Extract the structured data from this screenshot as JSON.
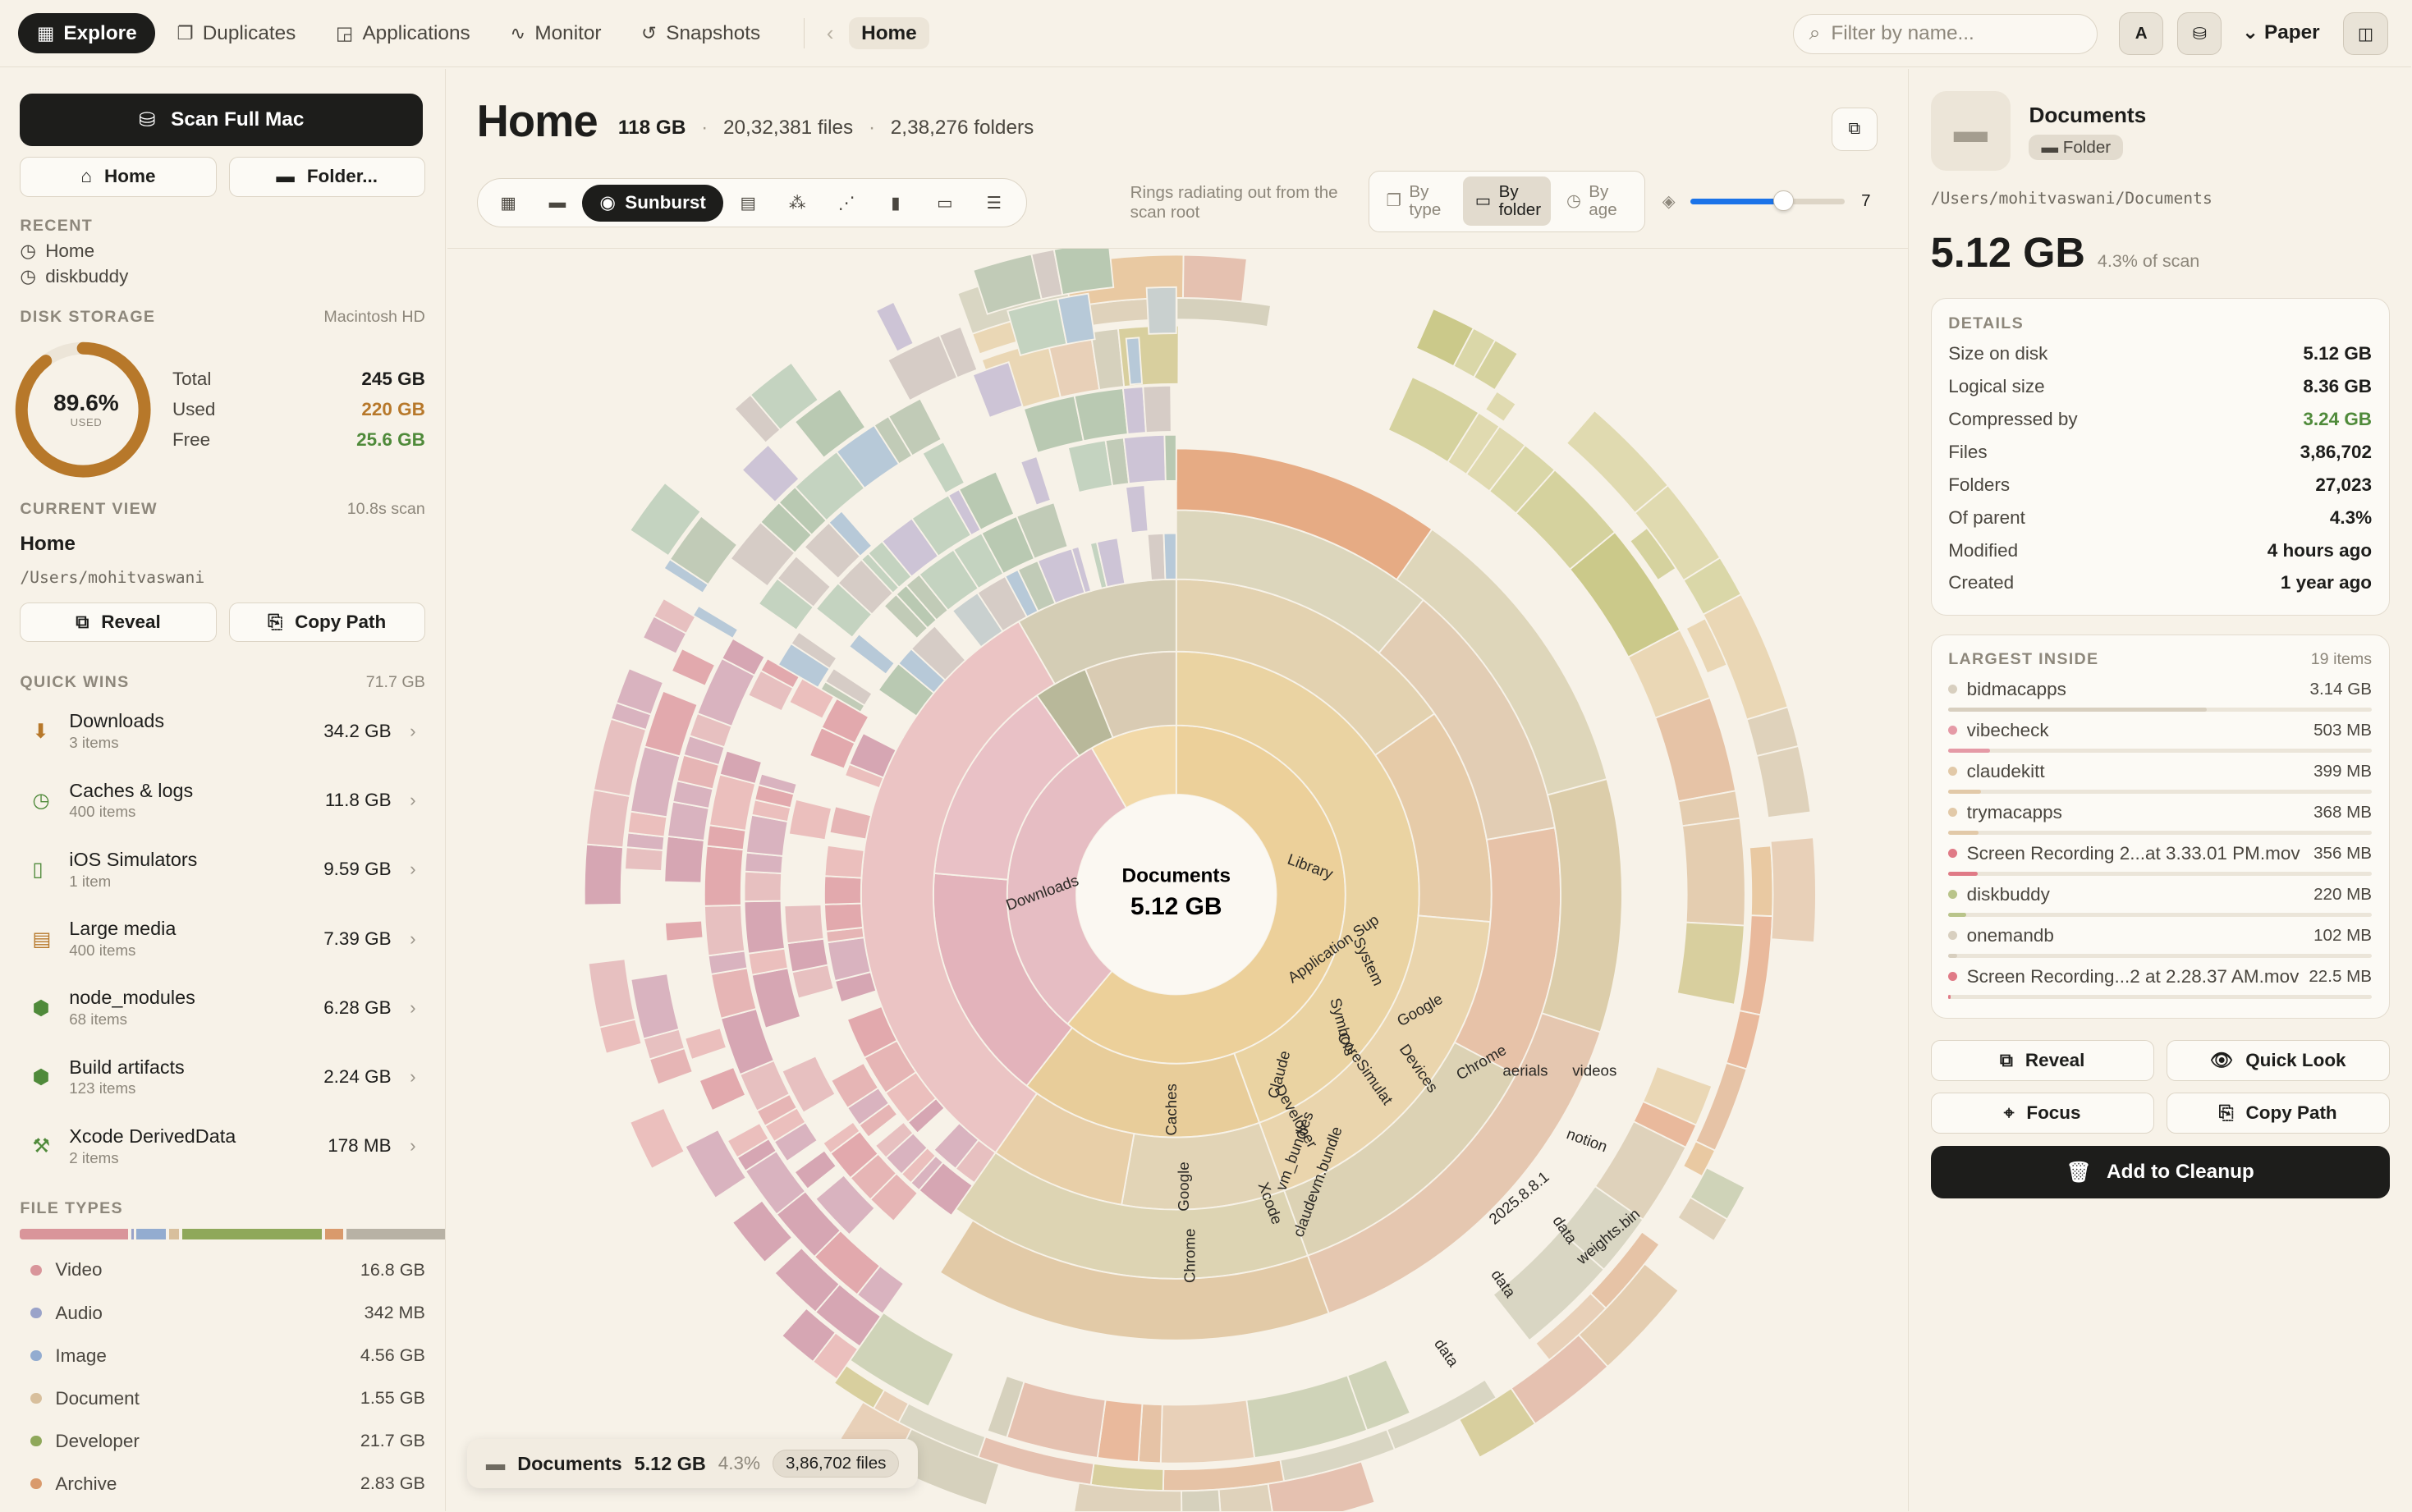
{
  "nav": {
    "tabs": [
      {
        "label": "Explore",
        "icon": "grid-icon"
      },
      {
        "label": "Duplicates",
        "icon": "copy-icon"
      },
      {
        "label": "Applications",
        "icon": "app-icon"
      },
      {
        "label": "Monitor",
        "icon": "pulse-icon"
      },
      {
        "label": "Snapshots",
        "icon": "history-icon"
      }
    ],
    "breadcrumb": "Home",
    "search_placeholder": "Filter by name...",
    "avatar_letter": "A",
    "theme_label": "Paper"
  },
  "sidebar": {
    "scan_label": "Scan Full Mac",
    "home_label": "Home",
    "folder_label": "Folder...",
    "recent_title": "RECENT",
    "recent": [
      "Home",
      "diskbuddy"
    ],
    "disk_title": "DISK STORAGE",
    "disk_name": "Macintosh HD",
    "disk_pct": "89.6%",
    "disk_pct_value": 0.896,
    "disk_used_label": "USED",
    "disk_stats": [
      {
        "label": "Total",
        "value": "245 GB",
        "color": "#1d1d1b"
      },
      {
        "label": "Used",
        "value": "220 GB",
        "color": "#b7782a"
      },
      {
        "label": "Free",
        "value": "25.6 GB",
        "color": "#4f8a3a"
      }
    ],
    "current_title": "CURRENT VIEW",
    "current_meta": "10.8s scan",
    "current_name": "Home",
    "current_path": "/Users/mohitvaswani",
    "reveal_label": "Reveal",
    "copy_path_label": "Copy Path",
    "quickwins_title": "QUICK WINS",
    "quickwins_total": "71.7 GB",
    "quickwins": [
      {
        "name": "Downloads",
        "sub": "3 items",
        "size": "34.2 GB",
        "icon": "download-icon"
      },
      {
        "name": "Caches & logs",
        "sub": "400 items",
        "size": "11.8 GB",
        "icon": "clock-icon"
      },
      {
        "name": "iOS Simulators",
        "sub": "1 item",
        "size": "9.59 GB",
        "icon": "phone-icon"
      },
      {
        "name": "Large media",
        "sub": "400 items",
        "size": "7.39 GB",
        "icon": "film-icon"
      },
      {
        "name": "node_modules",
        "sub": "68 items",
        "size": "6.28 GB",
        "icon": "package-icon"
      },
      {
        "name": "Build artifacts",
        "sub": "123 items",
        "size": "2.24 GB",
        "icon": "box-icon"
      },
      {
        "name": "Xcode DerivedData",
        "sub": "2 items",
        "size": "178 MB",
        "icon": "hammer-icon"
      }
    ],
    "filetypes_title": "FILE TYPES",
    "filetypes": [
      {
        "name": "Video",
        "size": "16.8 GB",
        "color": "#d9959a",
        "gb": 16.8
      },
      {
        "name": "Audio",
        "size": "342 MB",
        "color": "#9aa3c9",
        "gb": 0.342
      },
      {
        "name": "Image",
        "size": "4.56 GB",
        "color": "#93acd0",
        "gb": 4.56
      },
      {
        "name": "Document",
        "size": "1.55 GB",
        "color": "#d8bf9c",
        "gb": 1.55
      },
      {
        "name": "Developer",
        "size": "21.7 GB",
        "color": "#8fa85a",
        "gb": 21.7
      },
      {
        "name": "Archive",
        "size": "2.83 GB",
        "color": "#d99a6c",
        "gb": 2.83
      }
    ]
  },
  "main": {
    "title": "Home",
    "size": "118 GB",
    "files": "20,32,381 files",
    "folders": "2,38,276 folders",
    "active_view": "Sunburst",
    "view_description": "Rings radiating out from the scan root",
    "color_by": [
      {
        "label": "By type"
      },
      {
        "label": "By folder"
      },
      {
        "label": "By age"
      }
    ],
    "depth_value": "7",
    "depth_fraction": 0.6,
    "center_name": "Documents",
    "center_size": "5.12 GB",
    "ring_labels": [
      "Downloads",
      "Library",
      "Application Sup",
      "Claude",
      "vm_bundles",
      "claudevm.bundle",
      "Google",
      "Chrome",
      "aerials",
      "videos",
      "notion",
      "2025.8.8.1",
      "weights.bin",
      "Developer",
      "CoreSimulat",
      "Devices",
      "Caches",
      "Google",
      "Chrome",
      "Xcode",
      "Symbols",
      "System",
      "data",
      "data",
      "data"
    ],
    "hover": {
      "name": "Documents",
      "size": "5.12 GB",
      "pct": "4.3%",
      "files": "3,86,702 files"
    }
  },
  "details": {
    "name": "Documents",
    "kind": "Folder",
    "path": "/Users/mohitvaswani/Documents",
    "size": "5.12 GB",
    "pct": "4.3% of scan",
    "details_title": "DETAILS",
    "rows": [
      {
        "label": "Size on disk",
        "value": "5.12 GB"
      },
      {
        "label": "Logical size",
        "value": "8.36 GB"
      },
      {
        "label": "Compressed by",
        "value": "3.24 GB"
      },
      {
        "label": "Files",
        "value": "3,86,702"
      },
      {
        "label": "Folders",
        "value": "27,023"
      },
      {
        "label": "Of parent",
        "value": "4.3%"
      },
      {
        "label": "Modified",
        "value": "4 hours ago"
      },
      {
        "label": "Created",
        "value": "1 year ago"
      }
    ],
    "largest_title": "LARGEST INSIDE",
    "largest_count": "19 items",
    "largest": [
      {
        "name": "bidmacapps",
        "size": "3.14 GB",
        "color": "#d8cfbf",
        "fraction": 0.61
      },
      {
        "name": "vibecheck",
        "size": "503 MB",
        "color": "#e59aa6",
        "fraction": 0.098
      },
      {
        "name": "claudekitt",
        "size": "399 MB",
        "color": "#e2c9a8",
        "fraction": 0.078
      },
      {
        "name": "trymacapps",
        "size": "368 MB",
        "color": "#e2c9a8",
        "fraction": 0.072
      },
      {
        "name": "Screen Recording 2...at 3.33.01 PM.mov",
        "size": "356 MB",
        "color": "#e07a86",
        "fraction": 0.07
      },
      {
        "name": "diskbuddy",
        "size": "220 MB",
        "color": "#b9c48a",
        "fraction": 0.043
      },
      {
        "name": "onemandb",
        "size": "102 MB",
        "color": "#d8cfbf",
        "fraction": 0.02
      },
      {
        "name": "Screen Recording...2 at 2.28.37 AM.mov",
        "size": "22.5 MB",
        "color": "#e07a86",
        "fraction": 0.004
      }
    ],
    "actions": [
      "Reveal",
      "Quick Look",
      "Focus",
      "Copy Path"
    ],
    "cleanup_label": "Add to Cleanup"
  }
}
